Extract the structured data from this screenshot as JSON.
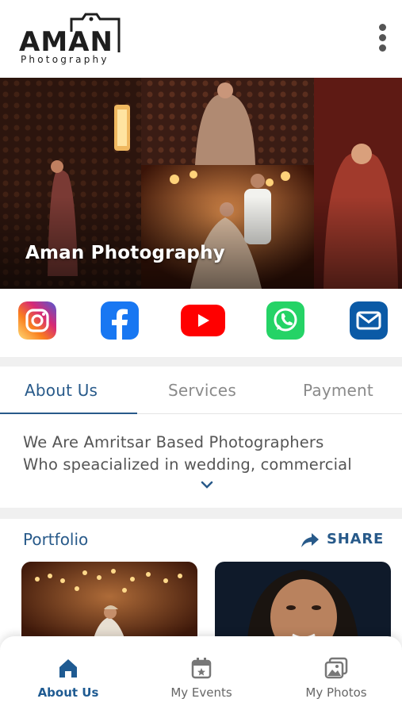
{
  "brand": {
    "logo_word": "AMAN",
    "logo_sub": "Photography"
  },
  "hero": {
    "title": "Aman Photography"
  },
  "social": [
    {
      "name": "instagram",
      "icon": "instagram-icon",
      "color": "#d6249f"
    },
    {
      "name": "facebook",
      "icon": "facebook-icon",
      "color": "#1877f2"
    },
    {
      "name": "youtube",
      "icon": "youtube-icon",
      "color": "#ff0000"
    },
    {
      "name": "whatsapp",
      "icon": "whatsapp-icon",
      "color": "#25d366"
    },
    {
      "name": "email",
      "icon": "mail-icon",
      "color": "#0b5aa6"
    }
  ],
  "tabs": [
    {
      "label": "About Us",
      "active": true
    },
    {
      "label": "Services",
      "active": false
    },
    {
      "label": "Payment",
      "active": false
    }
  ],
  "about": {
    "line1": "We Are Amritsar Based Photographers",
    "line2": "Who speacialized in wedding, commercial"
  },
  "portfolio": {
    "title": "Portfolio",
    "share_label": "SHARE"
  },
  "bottom_nav": [
    {
      "label": "About Us",
      "icon": "home-icon",
      "active": true
    },
    {
      "label": "My Events",
      "icon": "calendar-icon",
      "active": false
    },
    {
      "label": "My Photos",
      "icon": "photos-icon",
      "active": false
    }
  ],
  "colors": {
    "accent": "#285a8a",
    "nav_active": "#1f5b92"
  }
}
